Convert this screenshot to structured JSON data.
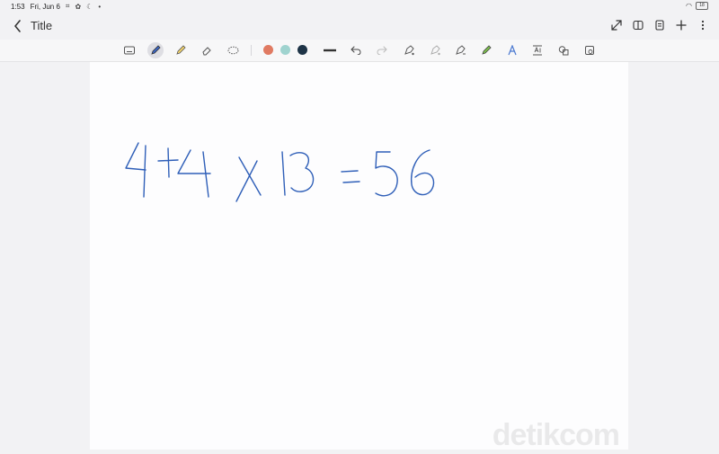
{
  "status_bar": {
    "time": "1:53",
    "date": "Fri, Jun 6",
    "battery": "18"
  },
  "nav": {
    "title": "Title"
  },
  "toolbar": {
    "colors": [
      "#e07a62",
      "#9fd3cf",
      "#1e3447"
    ],
    "active_tool": "pen"
  },
  "canvas": {
    "ink_color": "#2f5fb8"
  },
  "watermark": "detikcom"
}
